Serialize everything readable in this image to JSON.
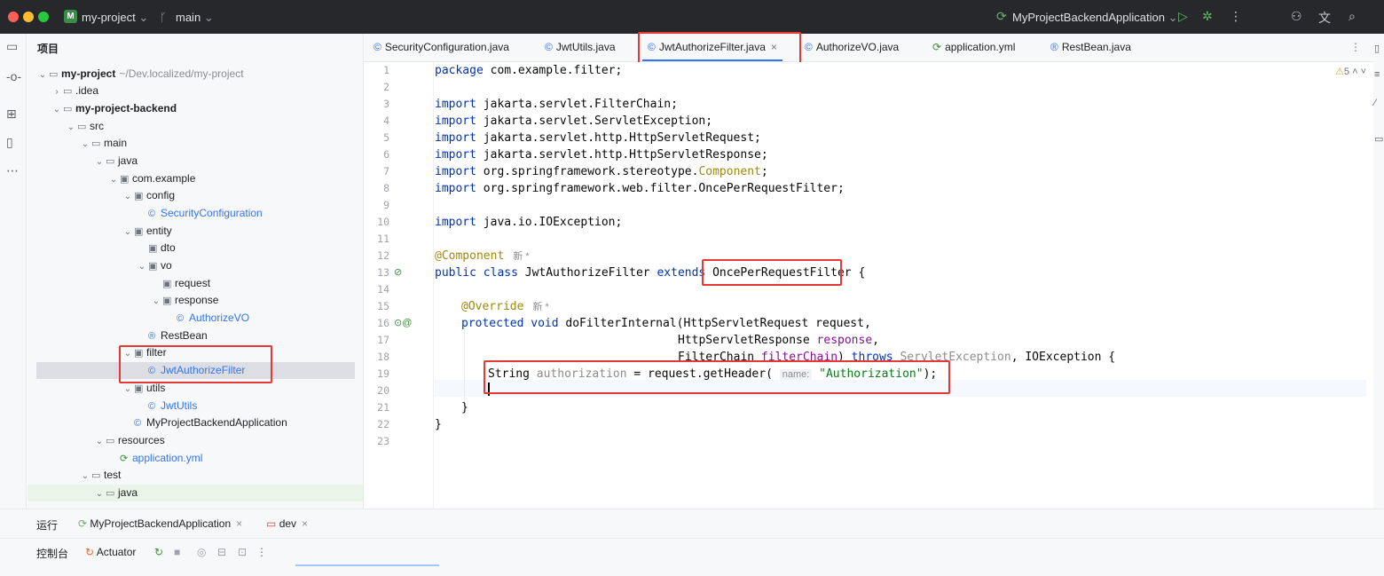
{
  "titlebar": {
    "project_badge": "M",
    "project_name": "my-project",
    "branch": "main",
    "run_config": "MyProjectBackendApplication"
  },
  "tree": {
    "header": "项目",
    "rows": [
      {
        "label": "my-project",
        "path": "~/Dev.localized/my-project"
      },
      {
        "label": ".idea"
      },
      {
        "label": "my-project-backend"
      },
      {
        "label": "src"
      },
      {
        "label": "main"
      },
      {
        "label": "java"
      },
      {
        "label": "com.example"
      },
      {
        "label": "config"
      },
      {
        "label": "SecurityConfiguration"
      },
      {
        "label": "entity"
      },
      {
        "label": "dto"
      },
      {
        "label": "vo"
      },
      {
        "label": "request"
      },
      {
        "label": "response"
      },
      {
        "label": "AuthorizeVO"
      },
      {
        "label": "RestBean"
      },
      {
        "label": "filter"
      },
      {
        "label": "JwtAuthorizeFilter"
      },
      {
        "label": "utils"
      },
      {
        "label": "JwtUtils"
      },
      {
        "label": "MyProjectBackendApplication"
      },
      {
        "label": "resources"
      },
      {
        "label": "application.yml"
      },
      {
        "label": "test"
      },
      {
        "label": "java"
      }
    ]
  },
  "tabs": [
    {
      "label": "SecurityConfiguration.java"
    },
    {
      "label": "JwtUtils.java"
    },
    {
      "label": "JwtAuthorizeFilter.java"
    },
    {
      "label": "AuthorizeVO.java"
    },
    {
      "label": "application.yml"
    },
    {
      "label": "RestBean.java"
    }
  ],
  "editor": {
    "line_numbers": [
      "1",
      "2",
      "3",
      "4",
      "5",
      "6",
      "7",
      "8",
      "9",
      "10",
      "11",
      "12",
      "13",
      "14",
      "15",
      "16",
      "17",
      "18",
      "19",
      "20",
      "21",
      "22",
      "23"
    ],
    "warning_count": "5",
    "new_marker": "新 *",
    "code": {
      "l1_kw": "package",
      "l1_rest": " com.example.filter;",
      "l3": "jakarta.servlet.FilterChain;",
      "l4": "jakarta.servlet.ServletException;",
      "l5": "jakarta.servlet.http.HttpServletRequest;",
      "l6": "jakarta.servlet.http.HttpServletResponse;",
      "l7a": "org.springframework.stereotype.",
      "l7b": "Component",
      "l7c": ";",
      "l8": "org.springframework.web.filter.OncePerRequestFilter;",
      "l10": "java.io.IOException;",
      "import_kw": "import",
      "l12": "@Component",
      "l13_kw": "public class",
      "l13_name": " JwtAuthorizeFilter ",
      "l13_ext": "extends",
      "l13_sup": "OncePerRequestFilter",
      "l13_brace": " {",
      "l15": "@Override",
      "l16_kw": "protected void",
      "l16_rest": " doFilterInternal(HttpServletRequest request,",
      "l17_a": "HttpServletResponse ",
      "l17_b": "response",
      "l17_c": ",",
      "l18_a": "FilterChain ",
      "l18_b": "filterChain",
      "l18_c": ") ",
      "l18_kw": "throws",
      "l18_d": " ServletException",
      "l18_e": ", IOException {",
      "l19_a": "String ",
      "l19_b": "authorization",
      "l19_c": " = request.getHeader(",
      "l19_hint": "name:",
      "l19_str": "\"Authorization\"",
      "l19_d": ");",
      "l21": "}",
      "l22": "}"
    }
  },
  "bottom": {
    "run_label": "运行",
    "run_tab": "MyProjectBackendApplication",
    "dev_tab": "dev",
    "console": "控制台",
    "actuator": "Actuator"
  }
}
